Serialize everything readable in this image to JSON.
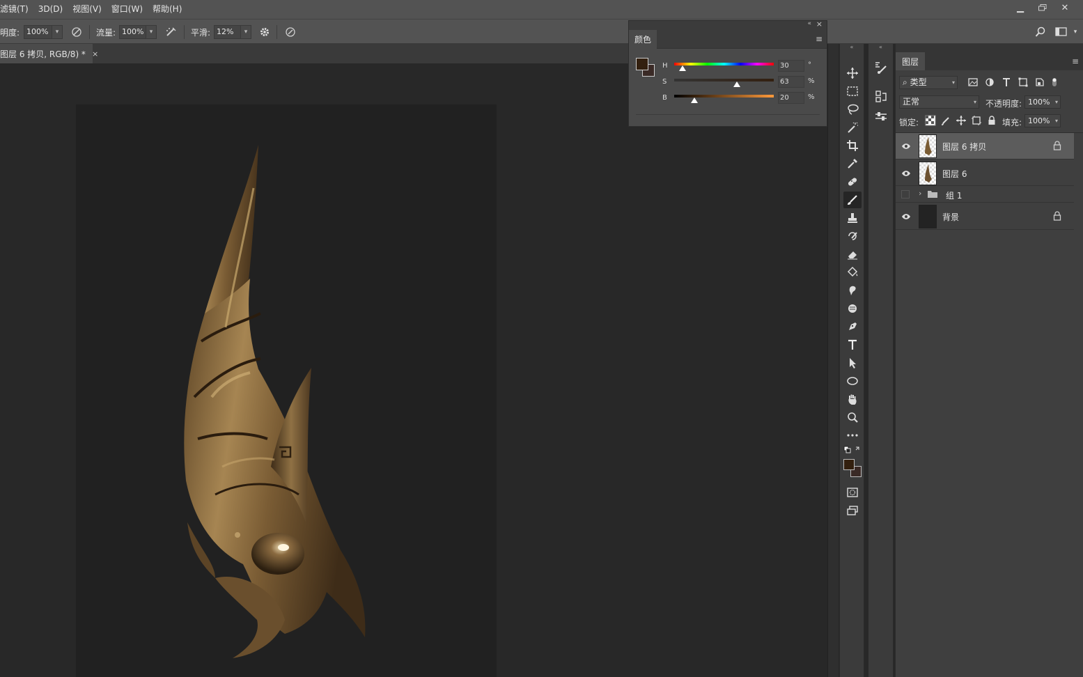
{
  "menu": {
    "items": [
      "滤镜(T)",
      "3D(D)",
      "视图(V)",
      "窗口(W)",
      "帮助(H)"
    ]
  },
  "options_bar": {
    "opacity_label": "明度:",
    "opacity_value": "100%",
    "flow_label": "流量:",
    "flow_value": "100%",
    "smoothing_label": "平滑:",
    "smoothing_value": "12%"
  },
  "document": {
    "tab_title": "图层 6 拷贝, RGB/8) *",
    "close_glyph": "×"
  },
  "color_panel": {
    "tab_label": "颜色",
    "foreground_color": "#33200f",
    "background_color": "#3a2a26",
    "sliders": [
      {
        "label": "H",
        "value": "30",
        "unit": "°",
        "fraction": 0.083
      },
      {
        "label": "S",
        "value": "63",
        "unit": "%",
        "fraction": 0.63
      },
      {
        "label": "B",
        "value": "20",
        "unit": "%",
        "fraction": 0.2
      }
    ]
  },
  "layers_panel": {
    "tab_label": "图层",
    "filter_kind": "类型",
    "blend_mode": "正常",
    "opacity_label": "不透明度:",
    "opacity_value": "100%",
    "lock_label": "锁定:",
    "fill_label": "填充:",
    "fill_value": "100%",
    "layers": [
      {
        "name": "图层 6 拷贝",
        "visible": true,
        "selected": true,
        "type": "pixel",
        "locked": true
      },
      {
        "name": "图层 6",
        "visible": true,
        "selected": false,
        "type": "pixel",
        "locked": false
      },
      {
        "name": "组 1",
        "visible": false,
        "selected": false,
        "type": "group",
        "locked": false
      },
      {
        "name": "背景",
        "visible": true,
        "selected": false,
        "type": "background",
        "locked": true
      }
    ]
  },
  "toolbar": {
    "tools": [
      "move-tool",
      "marquee-tool",
      "lasso-tool",
      "magic-wand-tool",
      "crop-tool",
      "eyedropper-tool",
      "healing-brush-tool",
      "brush-tool",
      "clone-stamp-tool",
      "history-brush-tool",
      "eraser-tool",
      "paint-bucket-tool",
      "smudge-tool",
      "dodge-tool",
      "pen-tool",
      "type-tool",
      "path-selection-tool",
      "ellipse-tool",
      "hand-tool",
      "zoom-tool",
      "more-tools"
    ],
    "active_tool": "brush-tool"
  },
  "colors": {
    "menu_bg": "#535353",
    "workspace_bg": "#282828",
    "canvas_bg": "#212121",
    "panel_bg": "#3f3f3f",
    "selected_layer": "#5c5c5c"
  }
}
